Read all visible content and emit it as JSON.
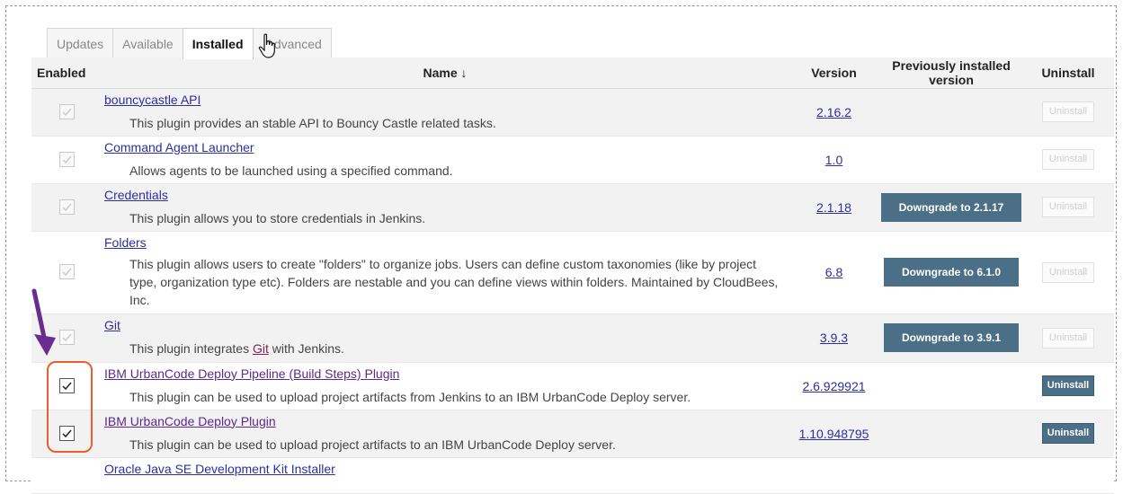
{
  "tabs": [
    {
      "label": "Updates",
      "active": false
    },
    {
      "label": "Available",
      "active": false
    },
    {
      "label": "Installed",
      "active": true
    },
    {
      "label": "Advanced",
      "active": false
    }
  ],
  "columns": {
    "enabled": "Enabled",
    "name": "Name ↓",
    "version": "Version",
    "previous": "Previously installed version",
    "uninstall": "Uninstall"
  },
  "plugins": [
    {
      "name": "bouncycastle API",
      "description": "This plugin provides an stable API to Bouncy Castle related tasks.",
      "version": "2.16.2",
      "previous": "",
      "enabled": true,
      "editable": false,
      "uninstall": "Uninstall",
      "uninstall_enabled": false
    },
    {
      "name": "Command Agent Launcher",
      "description": "Allows agents to be launched using a specified command.",
      "version": "1.0",
      "previous": "",
      "enabled": true,
      "editable": false,
      "uninstall": "Uninstall",
      "uninstall_enabled": false
    },
    {
      "name": "Credentials",
      "description": "This plugin allows you to store credentials in Jenkins.",
      "version": "2.1.18",
      "previous": "Downgrade to 2.1.17",
      "enabled": true,
      "editable": false,
      "uninstall": "Uninstall",
      "uninstall_enabled": false
    },
    {
      "name": "Folders",
      "description": "This plugin allows users to create \"folders\" to organize jobs. Users can define custom taxonomies (like by project type, organization type etc). Folders are nestable and you can define views within folders. Maintained by CloudBees, Inc.",
      "version": "6.8",
      "previous": "Downgrade to 6.1.0",
      "enabled": true,
      "editable": false,
      "uninstall": "Uninstall",
      "uninstall_enabled": false
    },
    {
      "name": "Git",
      "description_pre": "This plugin integrates ",
      "description_link": "Git",
      "description_post": " with Jenkins.",
      "version": "3.9.3",
      "previous": "Downgrade to 3.9.1",
      "enabled": true,
      "editable": false,
      "uninstall": "Uninstall",
      "uninstall_enabled": false
    },
    {
      "name": "IBM UrbanCode Deploy Pipeline (Build Steps) Plugin",
      "description": "This plugin can be used to upload project artifacts from Jenkins to an IBM UrbanCode Deploy server.",
      "version": "2.6.929921",
      "previous": "",
      "enabled": true,
      "editable": true,
      "uninstall": "Uninstall",
      "uninstall_enabled": true
    },
    {
      "name": "IBM UrbanCode Deploy Plugin",
      "description": "This plugin can be used to upload project artifacts to an IBM UrbanCode Deploy server.",
      "version": "1.10.948795",
      "previous": "",
      "enabled": true,
      "editable": true,
      "uninstall": "Uninstall",
      "uninstall_enabled": true
    },
    {
      "name": "Oracle Java SE Development Kit Installer",
      "description": "",
      "version": "",
      "previous": "",
      "enabled": true,
      "editable": false,
      "uninstall": "",
      "uninstall_enabled": false
    }
  ],
  "colors": {
    "link": "#2b2fa0",
    "button": "#4b6f86",
    "highlight": "#e8602a",
    "arrow": "#6a2c91"
  }
}
